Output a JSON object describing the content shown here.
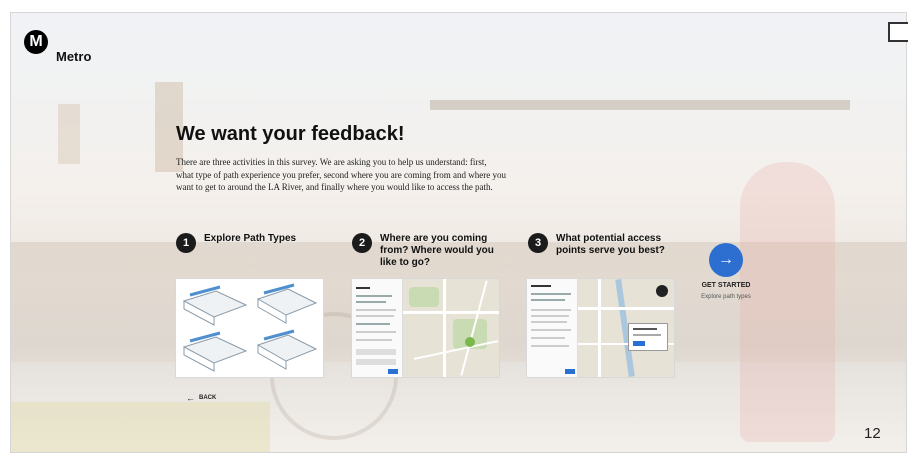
{
  "brand": {
    "logo_letter": "M",
    "name": "Metro"
  },
  "heading": "We want your feedback!",
  "intro": "There are three activities in this survey. We are asking you to help us understand: first, what type of path experience you prefer, second where you are coming from and where you want to get to around the LA River, and finally where you would like to access the path.",
  "steps": [
    {
      "number": "1",
      "label": "Explore Path Types"
    },
    {
      "number": "2",
      "label": "Where are you coming from? Where would you like to go?"
    },
    {
      "number": "3",
      "label": "What potential access points serve you best?"
    }
  ],
  "start": {
    "icon": "→",
    "label": "GET STARTED",
    "sublabel": "Explore path types"
  },
  "back": {
    "icon": "←",
    "label": "BACK"
  },
  "page_number": "12",
  "colors": {
    "accent": "#2d6fd1",
    "text": "#111111"
  }
}
